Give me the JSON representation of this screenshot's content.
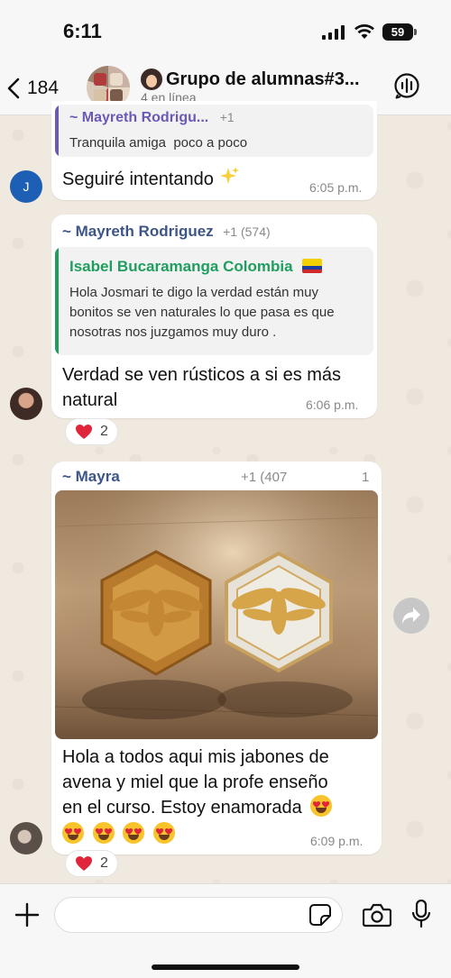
{
  "status_bar": {
    "time": "6:11",
    "battery": "59"
  },
  "header": {
    "back_count": "184",
    "title": "Grupo de alumnas#3...",
    "subtitle": "4 en línea"
  },
  "messages": [
    {
      "quote_sender": "~ Mayreth Rodrigu...",
      "quote_sender_extra": "+1",
      "quote_text": "Tranquila amiga  poco a poco",
      "text": "Seguiré intentando",
      "time": "6:05 p.m.",
      "avatar_letter": "J"
    },
    {
      "sender": "~ Mayreth Rodriguez",
      "sender_extra": "+1 (574)",
      "quote_sender": "Isabel Bucaramanga Colombia",
      "quote_text": "Hola Josmari te digo la verdad están muy bonitos se ven naturales lo que pasa es que nosotras nos juzgamos muy duro .",
      "text_line1": "Verdad se ven rústicos a si es más",
      "text_line2": "natural",
      "time": "6:06 p.m.",
      "reaction_count": "2"
    },
    {
      "sender": "~ Mayra",
      "sender_extra": "+1 (407",
      "sender_extra2": "1",
      "text_line1": "Hola a todos aqui mis jabones de",
      "text_line2": "avena y miel que la profe enseño",
      "text_line3": "en el curso. Estoy enamorada",
      "time": "6:09 p.m.",
      "reaction_count": "2"
    }
  ],
  "colors": {
    "quote_bar_purple": "#6c58b8",
    "quote_bar_green": "#1f9e5f",
    "quote_sender_green": "#1f9e5f",
    "sender_blue": "#3e5687",
    "avatar_blue": "#1d5fb5"
  },
  "icons": [
    "back-chevron-icon",
    "signal-icon",
    "wifi-icon",
    "voice-chat-icon",
    "sparkles-icon",
    "colombia-flag-icon",
    "heart-icon",
    "heart-eyes-emoji-icon",
    "forward-icon",
    "plus-icon",
    "sticker-icon",
    "camera-icon",
    "microphone-icon"
  ]
}
